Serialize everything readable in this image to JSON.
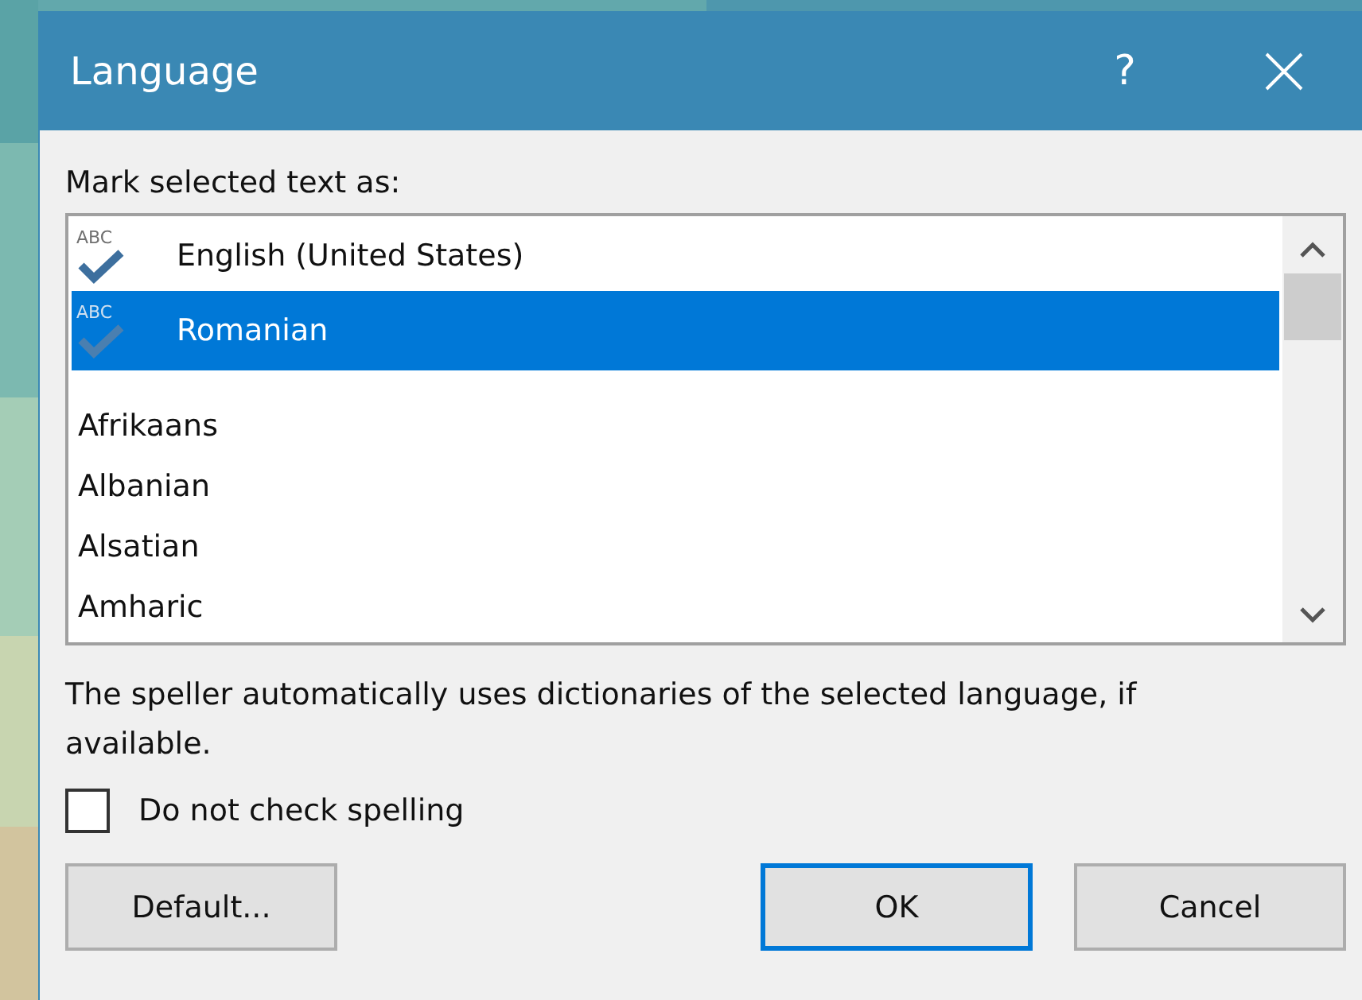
{
  "window": {
    "title": "Language",
    "help": "?"
  },
  "label": "Mark selected text as:",
  "languages": [
    {
      "name": "English (United States)",
      "kind": "proofing",
      "icon_text": "ABC",
      "selected": false
    },
    {
      "name": "Romanian",
      "kind": "proofing",
      "icon_text": "ABC",
      "selected": true
    },
    {
      "name": "Afrikaans",
      "kind": "plain",
      "selected": false
    },
    {
      "name": "Albanian",
      "kind": "plain",
      "selected": false
    },
    {
      "name": "Alsatian",
      "kind": "plain",
      "selected": false
    },
    {
      "name": "Amharic",
      "kind": "plain",
      "selected": false
    }
  ],
  "note": "The speller automatically uses dictionaries of the selected language, if available.",
  "no_check": {
    "label": "Do not check spelling",
    "checked": false
  },
  "buttons": [
    {
      "label": "Default...",
      "default": false
    },
    {
      "label": "OK",
      "default": true
    },
    {
      "label": "Cancel",
      "default": false
    }
  ]
}
